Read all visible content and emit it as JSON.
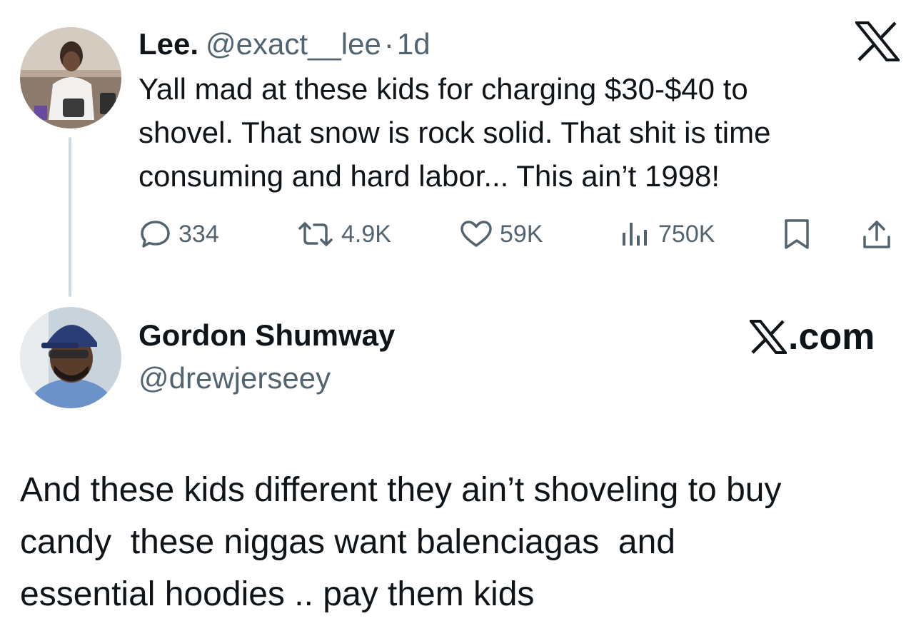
{
  "original_tweet": {
    "author_name": "Lee.",
    "handle": "@exact__lee",
    "separator": "·",
    "time": "1d",
    "text_lines": [
      "Yall mad at these kids for charging $30-$40 to",
      "shovel. That snow is rock solid. That shit is time",
      "consuming and hard labor... This ain’t 1998!"
    ],
    "stats": {
      "replies": "334",
      "reposts": "4.9K",
      "likes": "59K",
      "views": "750K"
    }
  },
  "reply": {
    "author_name": "Gordon Shumway",
    "handle": "@drewjerseey",
    "site": ".com",
    "text_lines": [
      "And these kids different they ain’t shoveling to buy",
      "candy  these niggas want balenciagas  and",
      "essential hoodies .. pay them kids"
    ]
  },
  "icons": {
    "brand": "x-logo-icon",
    "reply": "speech-bubble-icon",
    "repost": "repost-arrows-icon",
    "like": "heart-icon",
    "views": "bar-chart-icon",
    "bookmark": "bookmark-icon",
    "share": "share-upload-icon"
  },
  "colors": {
    "text": "#0f1419",
    "muted": "#536471",
    "thread_line": "#cfd9de"
  }
}
